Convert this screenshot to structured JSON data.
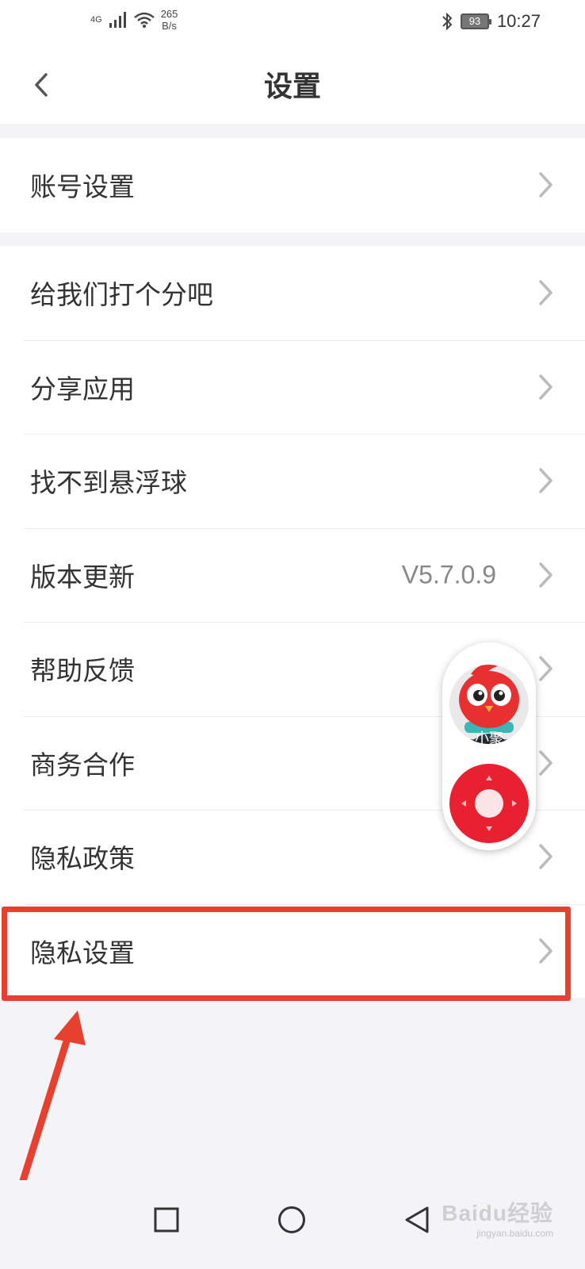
{
  "status_bar": {
    "network": "4G",
    "speed_value": "265",
    "speed_unit": "B/s",
    "battery": "93",
    "time": "10:27"
  },
  "header": {
    "title": "设置"
  },
  "groups": [
    {
      "items": [
        {
          "label": "账号设置"
        }
      ]
    },
    {
      "items": [
        {
          "label": "给我们打个分吧"
        },
        {
          "label": "分享应用"
        },
        {
          "label": "找不到悬浮球"
        },
        {
          "label": "版本更新",
          "value": "V5.7.0.9"
        },
        {
          "label": "帮助反馈"
        },
        {
          "label": "商务合作"
        },
        {
          "label": "隐私政策"
        },
        {
          "label": "隐私设置",
          "highlighted": true
        }
      ]
    }
  ],
  "floating_widget": {
    "mascot_label": "小聚"
  },
  "watermark": {
    "text": "Baidu经验",
    "sub": "jingyan.baidu.com"
  },
  "colors": {
    "highlight": "#e8402f",
    "accent_red": "#e8202f",
    "background": "#f4f4f6"
  }
}
